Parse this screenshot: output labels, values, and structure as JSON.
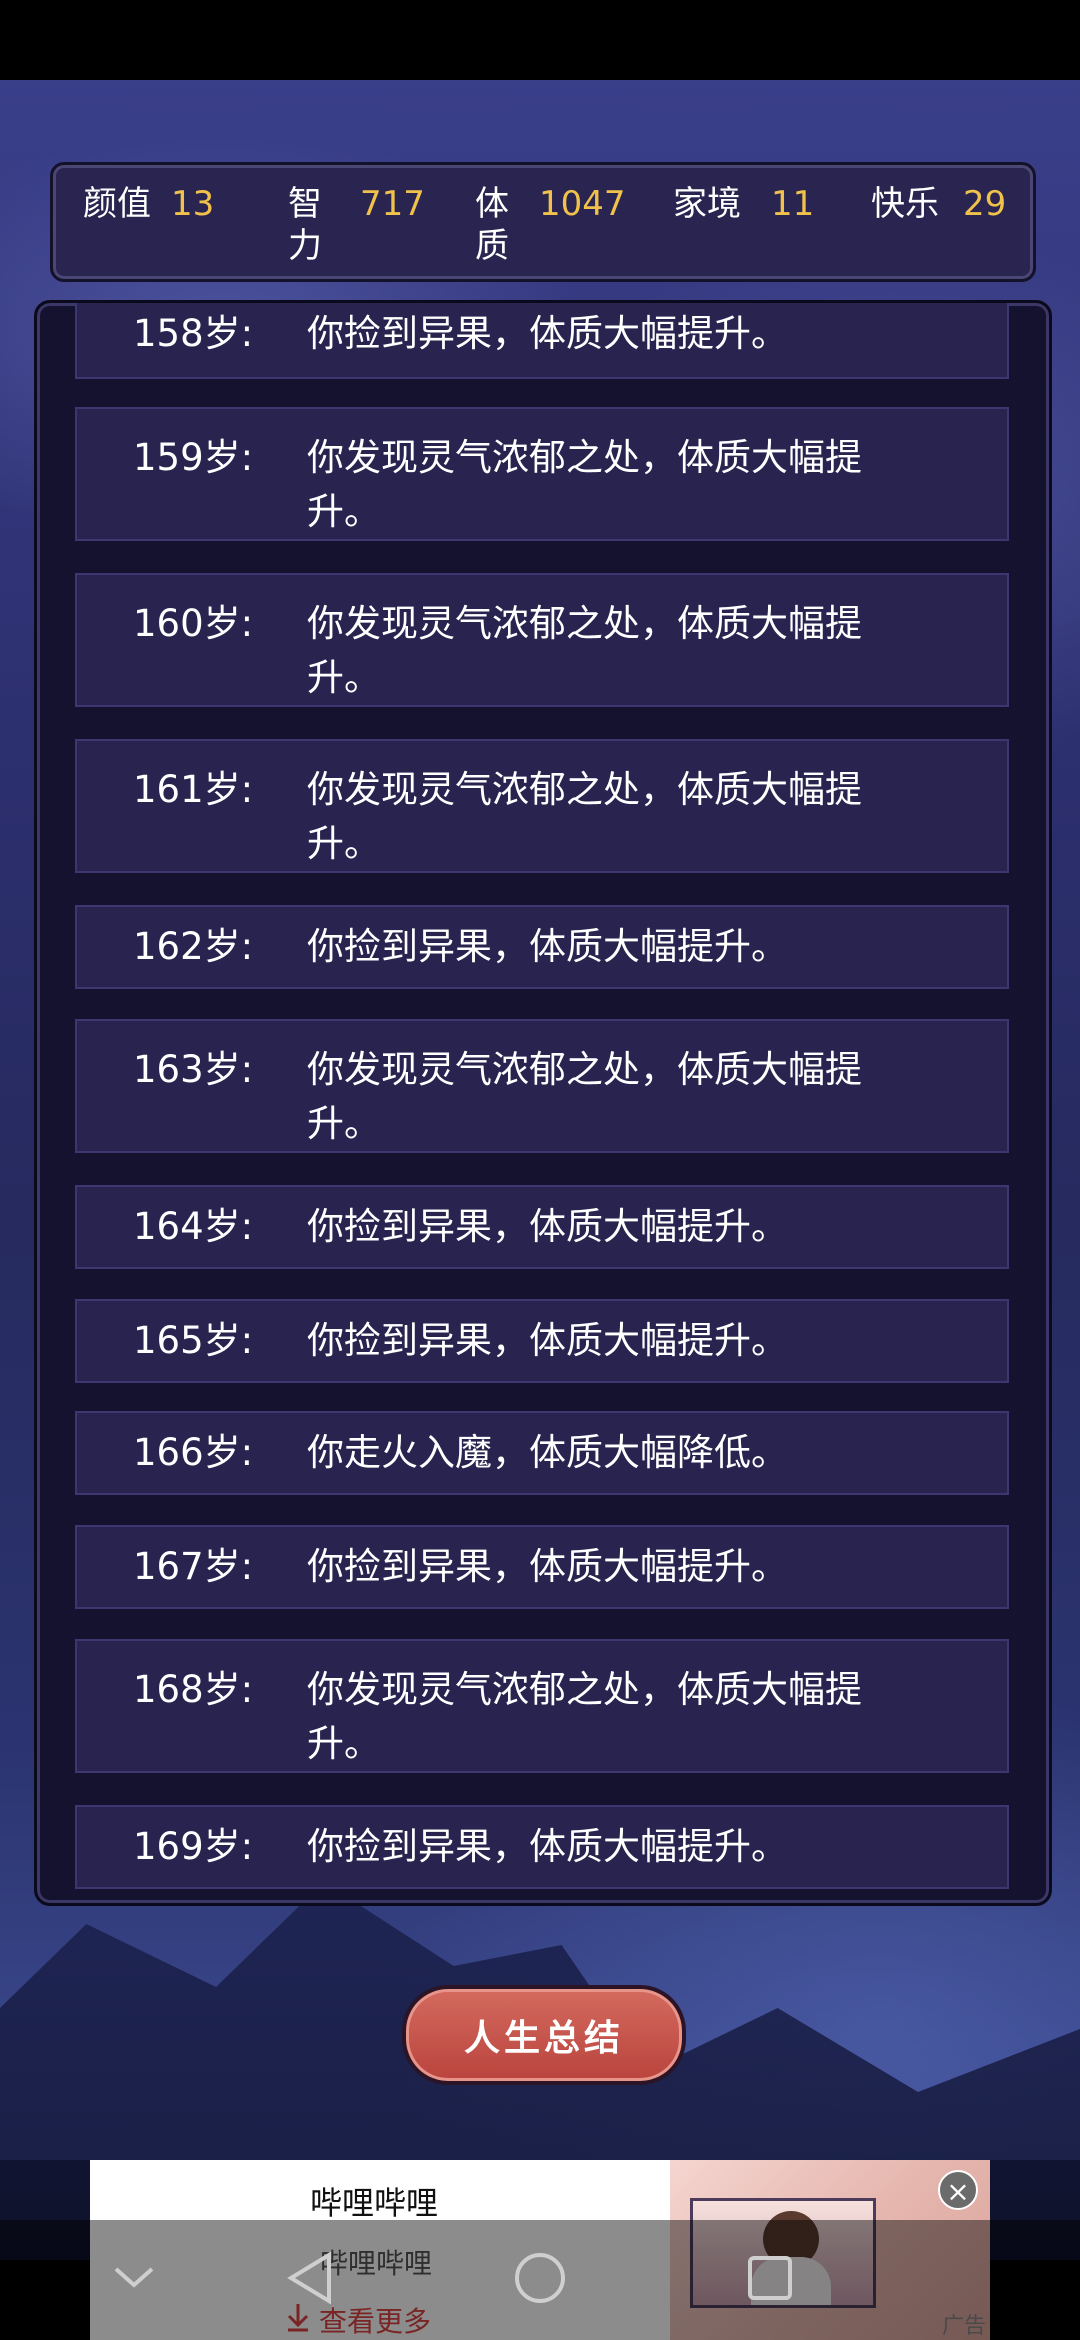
{
  "stats": [
    {
      "label": "颜值",
      "value": "13"
    },
    {
      "label": "智力",
      "value": "717"
    },
    {
      "label": "体质",
      "value": "1047"
    },
    {
      "label": "家境",
      "value": "11"
    },
    {
      "label": "快乐",
      "value": "29"
    }
  ],
  "log": [
    {
      "age": "158岁:",
      "text": "你捡到异果，体质大幅提升。"
    },
    {
      "age": "159岁:",
      "text": "你发现灵气浓郁之处，体质大幅提升。"
    },
    {
      "age": "160岁:",
      "text": "你发现灵气浓郁之处，体质大幅提升。"
    },
    {
      "age": "161岁:",
      "text": "你发现灵气浓郁之处，体质大幅提升。"
    },
    {
      "age": "162岁:",
      "text": "你捡到异果，体质大幅提升。"
    },
    {
      "age": "163岁:",
      "text": "你发现灵气浓郁之处，体质大幅提升。"
    },
    {
      "age": "164岁:",
      "text": "你捡到异果，体质大幅提升。"
    },
    {
      "age": "165岁:",
      "text": "你捡到异果，体质大幅提升。"
    },
    {
      "age": "166岁:",
      "text": "你走火入魔，体质大幅降低。"
    },
    {
      "age": "167岁:",
      "text": "你捡到异果，体质大幅提升。"
    },
    {
      "age": "168岁:",
      "text": "你发现灵气浓郁之处，体质大幅提升。"
    },
    {
      "age": "169岁:",
      "text": "你捡到异果，体质大幅提升。"
    }
  ],
  "summary_button": "人生总结",
  "ad": {
    "title": "哔哩哔哩",
    "subtitle": "哔哩哔哩",
    "more": "查看更多",
    "tag": "广告",
    "close": "×"
  },
  "colors": {
    "stat_value": "#f0c14b",
    "panel_bg": "#28234f",
    "button": "#c7534a"
  }
}
